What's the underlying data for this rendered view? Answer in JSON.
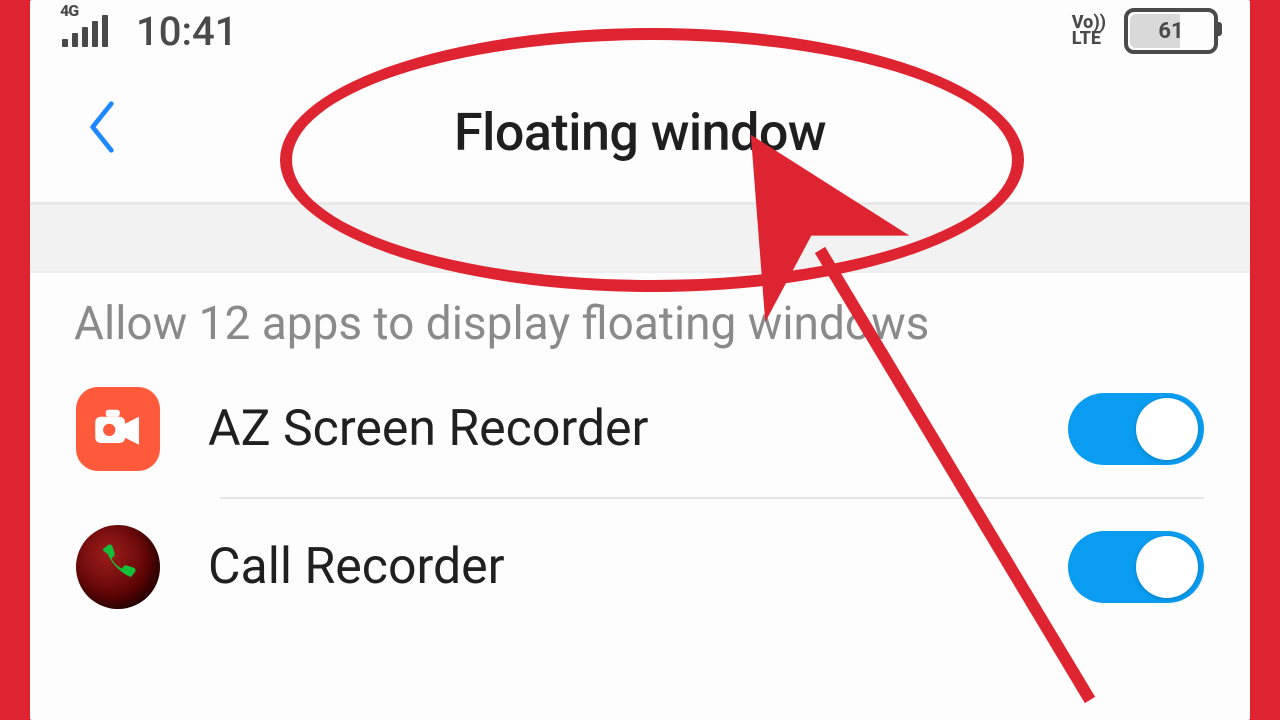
{
  "status": {
    "network_gen": "4G",
    "time": "10:41",
    "volte_top": "Vo))",
    "volte_bottom": "LTE",
    "battery_pct": "61"
  },
  "page": {
    "title": "Floating window"
  },
  "section": {
    "label": "Allow 12 apps to display floating windows"
  },
  "apps": {
    "0": {
      "name": "AZ Screen Recorder",
      "enabled": true
    },
    "1": {
      "name": "Call Recorder",
      "enabled": true
    }
  },
  "annotation": {
    "highlight_color": "#df2431"
  }
}
